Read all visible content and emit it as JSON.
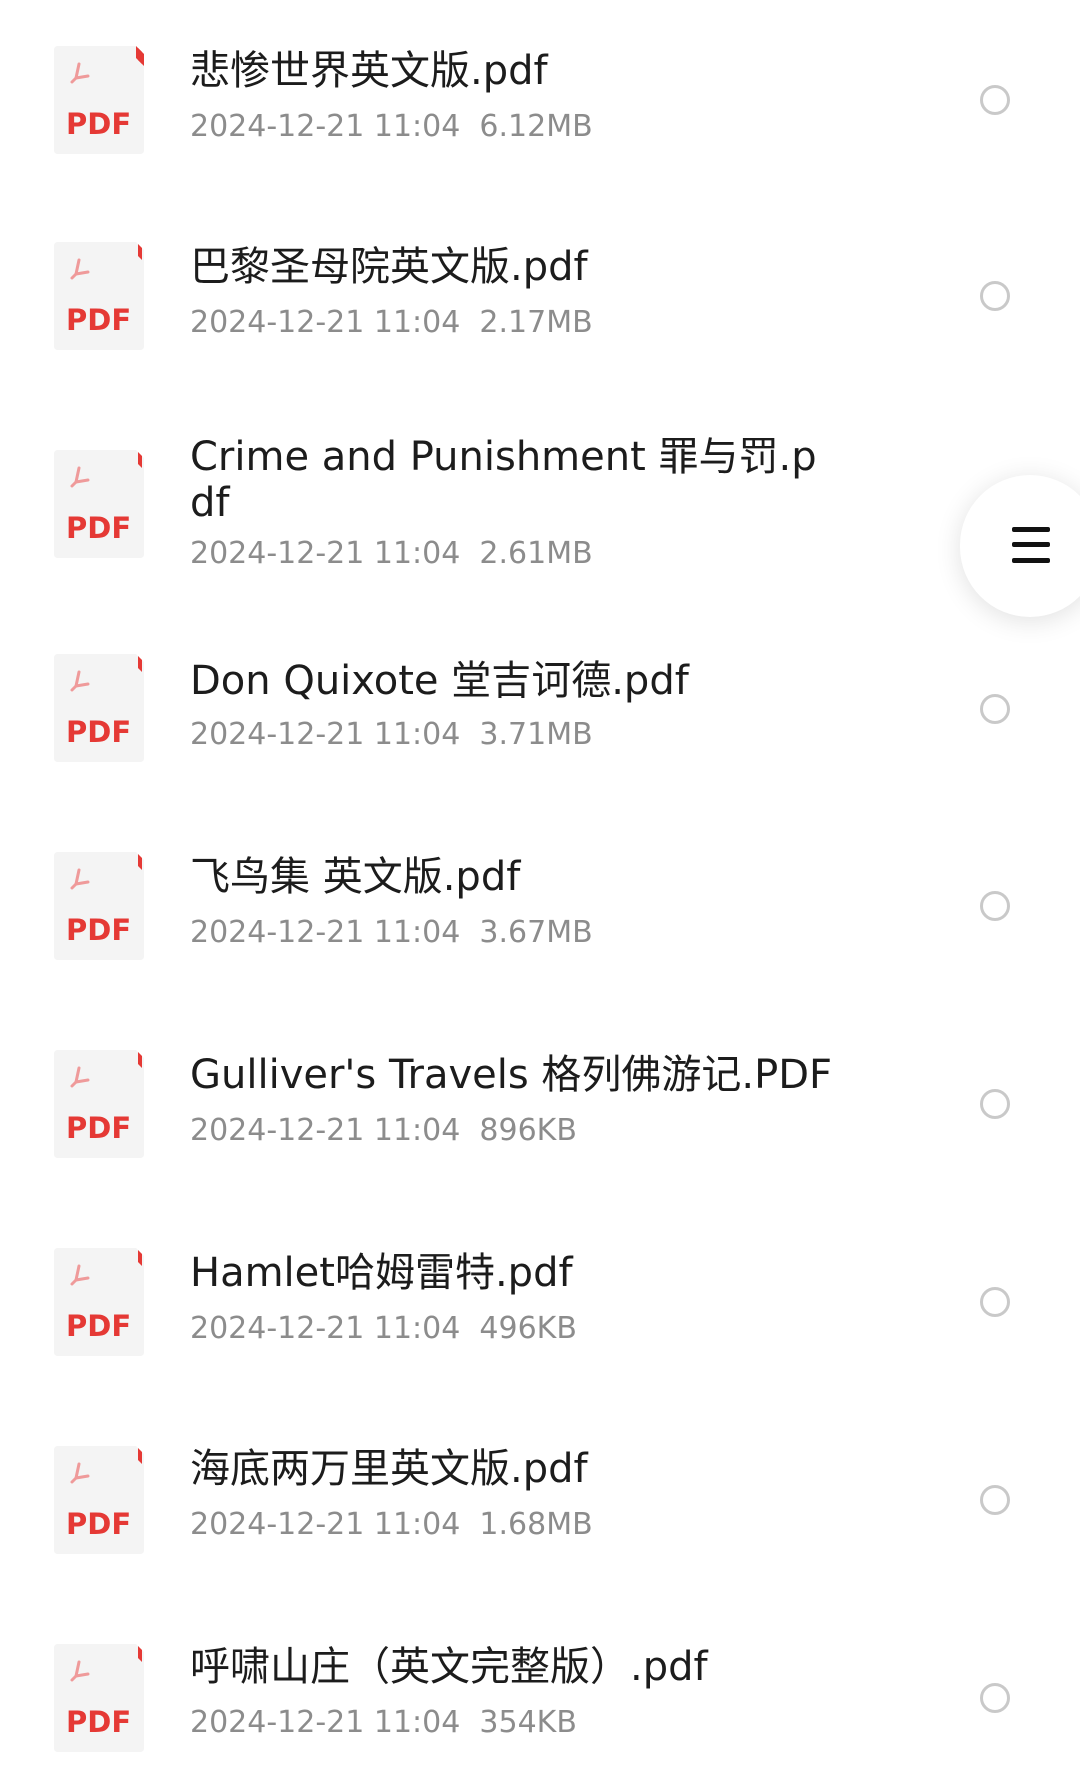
{
  "files": [
    {
      "name": "悲惨世界英文版.pdf",
      "date": "2024-12-21 11:04",
      "size": "6.12MB",
      "icon_label": "PDF",
      "icon": "pdf-file-icon"
    },
    {
      "name": "巴黎圣母院英文版.pdf",
      "date": "2024-12-21 11:04",
      "size": "2.17MB",
      "icon_label": "PDF",
      "icon": "pdf-file-icon"
    },
    {
      "name": "Crime and Punishment 罪与罚.pdf",
      "date": "2024-12-21 11:04",
      "size": "2.61MB",
      "icon_label": "PDF",
      "icon": "pdf-file-icon"
    },
    {
      "name": "Don Quixote 堂吉诃德.pdf",
      "date": "2024-12-21 11:04",
      "size": "3.71MB",
      "icon_label": "PDF",
      "icon": "pdf-file-icon"
    },
    {
      "name": "飞鸟集 英文版.pdf",
      "date": "2024-12-21 11:04",
      "size": "3.67MB",
      "icon_label": "PDF",
      "icon": "pdf-file-icon"
    },
    {
      "name": "Gulliver's Travels 格列佛游记.PDF",
      "date": "2024-12-21 11:04",
      "size": "896KB",
      "icon_label": "PDF",
      "icon": "pdf-file-icon"
    },
    {
      "name": "Hamlet哈姆雷特.pdf",
      "date": "2024-12-21 11:04",
      "size": "496KB",
      "icon_label": "PDF",
      "icon": "pdf-file-icon"
    },
    {
      "name": "海底两万里英文版.pdf",
      "date": "2024-12-21 11:04",
      "size": "1.68MB",
      "icon_label": "PDF",
      "icon": "pdf-file-icon"
    },
    {
      "name": "呼啸山庄（英文完整版）.pdf",
      "date": "2024-12-21 11:04",
      "size": "354KB",
      "icon_label": "PDF",
      "icon": "pdf-file-icon"
    }
  ],
  "floating_button": {
    "icon": "menu-icon"
  },
  "colors": {
    "pdf_red": "#e53935",
    "pdf_icon_bg": "#f4f4f4",
    "text_primary": "#1c1c1c",
    "text_secondary": "#8c8c8c",
    "radio_border": "#c9c9c9"
  }
}
